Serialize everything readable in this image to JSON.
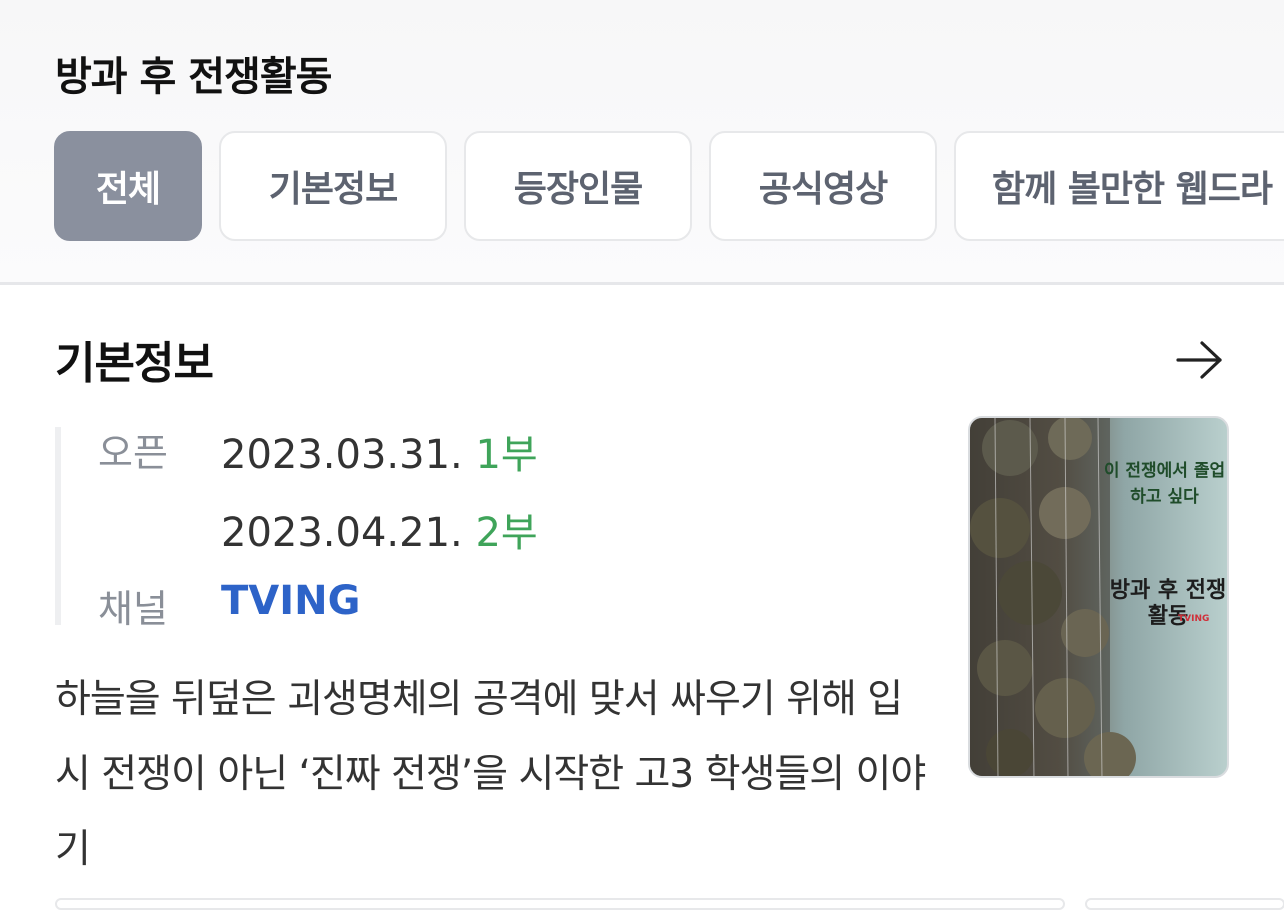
{
  "header": {
    "title": "방과 후 전쟁활동"
  },
  "tabs": [
    {
      "label": "전체",
      "active": true
    },
    {
      "label": "기본정보",
      "active": false
    },
    {
      "label": "등장인물",
      "active": false
    },
    {
      "label": "공식영상",
      "active": false
    },
    {
      "label": "함께 볼만한 웹드라",
      "active": false
    }
  ],
  "basic_info": {
    "section_title": "기본정보",
    "open_label": "오픈",
    "open_dates": [
      {
        "date": "2023.03.31.",
        "part": "1부"
      },
      {
        "date": "2023.04.21.",
        "part": "2부"
      }
    ],
    "channel_label": "채널",
    "channel": "TVING",
    "description": "하늘을 뒤덮은 괴생명체의 공격에 맞서 싸우기 위해 입시 전쟁이 아닌 ‘진짜 전쟁’을 시작한 고3 학생들의 이야기"
  },
  "poster": {
    "tagline": "이 전쟁에서 졸업하고 싶다",
    "title": "방과 후 전쟁활동",
    "logo": "TVING"
  },
  "colors": {
    "active_tab_bg": "#8a909e",
    "part_green": "#3fa45a",
    "channel_blue": "#2d63c8"
  }
}
